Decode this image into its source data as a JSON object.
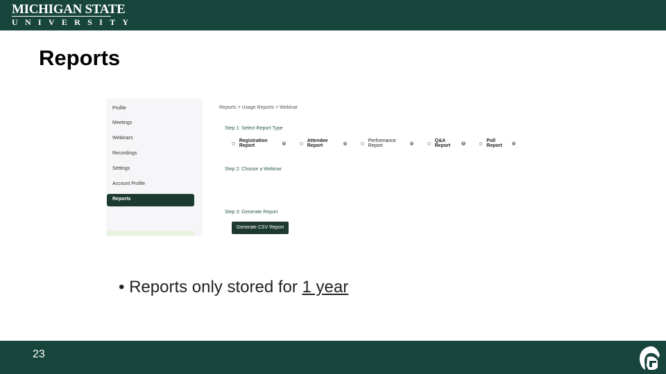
{
  "header": {
    "logo_line1": "MICHIGAN STATE",
    "logo_line2": "UNIVERSITY"
  },
  "title": "Reports",
  "screenshot": {
    "sidebar": [
      "Profile",
      "Meetings",
      "Webinars",
      "Recordings",
      "Settings",
      "Account Profile"
    ],
    "sidebar_active": "Reports",
    "breadcrumb": "Reports  >  Usage Reports  >  Webinar",
    "step1": "Step 1: Select Report Type",
    "report_types": [
      "Registration Report",
      "Attendee Report",
      "Performance Report",
      "Q&A Report",
      "Poll Report"
    ],
    "step2": "Step 2: Choose a Webinar",
    "step3": "Step 3: Generate Report",
    "generate_button": "Generate CSV Report"
  },
  "bullet": {
    "text": "Reports only stored for ",
    "emphasis": "1 year"
  },
  "footer": {
    "page_number": "23"
  }
}
